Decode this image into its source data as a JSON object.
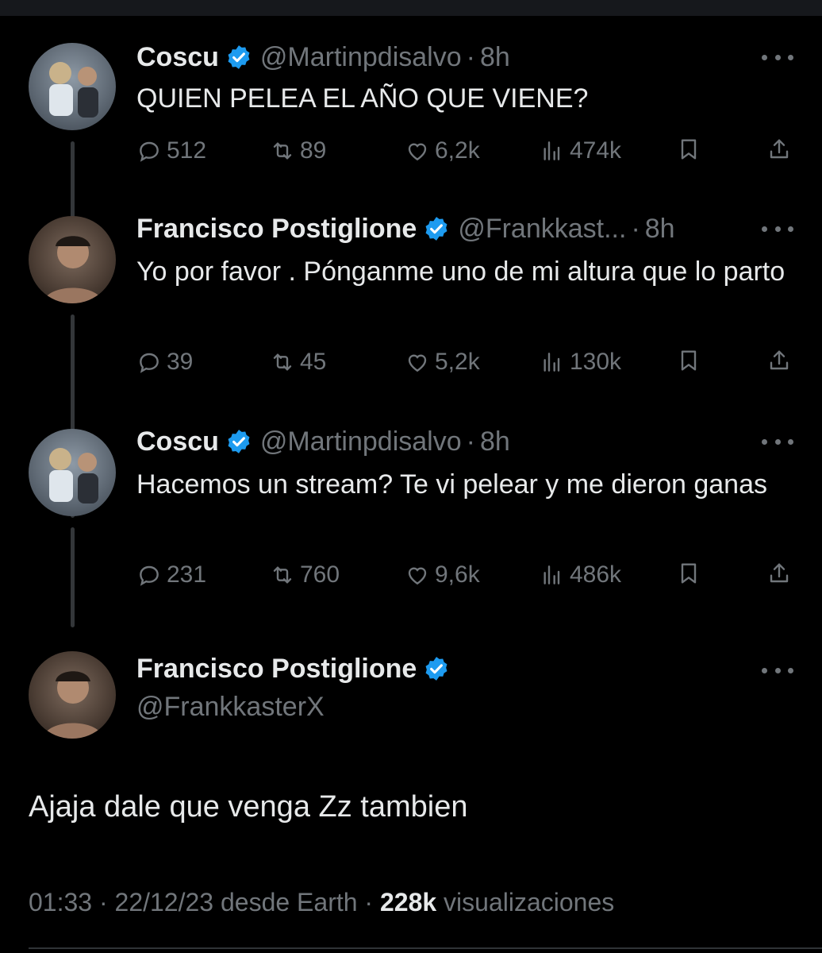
{
  "colors": {
    "background": "#000000",
    "text": "#e7e9ea",
    "secondary": "#71767b",
    "verified": "#1d9bf0"
  },
  "tweets": [
    {
      "name": "Coscu",
      "handle": "@Martinpdisalvo",
      "sep": "·",
      "time": "8h",
      "text": "QUIEN PELEA EL AÑO QUE VIENE?",
      "replies": "512",
      "retweets": "89",
      "likes": "6,2k",
      "views": "474k"
    },
    {
      "name": "Francisco Postiglione",
      "handle": "@Frankkast...",
      "sep": "·",
      "time": "8h",
      "text": "Yo por favor . Pónganme uno de mi altura que lo parto",
      "replies": "39",
      "retweets": "45",
      "likes": "5,2k",
      "views": "130k"
    },
    {
      "name": "Coscu",
      "handle": "@Martinpdisalvo",
      "sep": "·",
      "time": "8h",
      "text": "Hacemos un stream? Te vi pelear y me dieron ganas",
      "replies": "231",
      "retweets": "760",
      "likes": "9,6k",
      "views": "486k"
    }
  ],
  "main": {
    "name": "Francisco Postiglione",
    "handle": "@FrankkasterX",
    "text": "Ajaja dale que venga Zz tambien",
    "time": "01:33",
    "sep1": "·",
    "date": "22/12/23",
    "source": "desde Earth",
    "sep2": "·",
    "views": "228k",
    "views_label": "visualizaciones"
  },
  "icons": [
    "reply-icon",
    "retweet-icon",
    "like-icon",
    "views-icon",
    "bookmark-icon",
    "share-icon",
    "more-icon",
    "verified-badge-icon"
  ]
}
